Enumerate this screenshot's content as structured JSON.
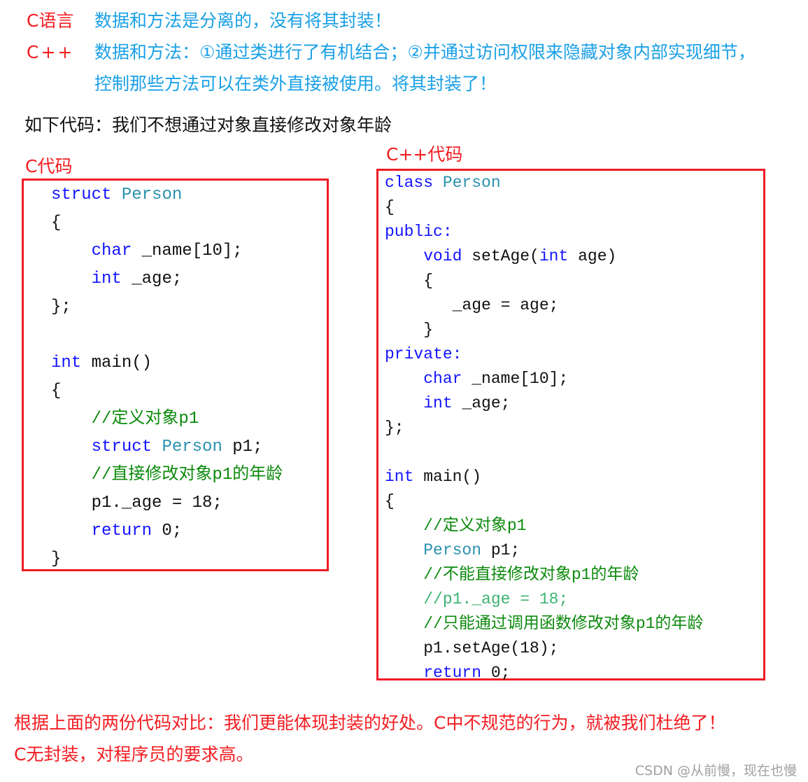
{
  "intro": {
    "c_label": "C语言",
    "c_text": "数据和方法是分离的，没有将其封装！",
    "cpp_label": "C++",
    "cpp_text_1": "数据和方法：①通过类进行了有机结合；②并通过访问权限来隐藏对象内部实现细节，",
    "cpp_text_2": "控制那些方法可以在类外直接被使用。将其封装了！",
    "code_intro": "如下代码：我们不想通过对象直接修改对象年龄"
  },
  "code_left": {
    "title": "C代码",
    "lines": [
      [
        [
          "struct",
          "kw"
        ],
        [
          " ",
          ""
        ],
        [
          "Person",
          "ty"
        ]
      ],
      [
        [
          "{",
          ""
        ]
      ],
      [
        [
          "    ",
          ""
        ],
        [
          "char",
          "kw"
        ],
        [
          " _name[10];",
          ""
        ]
      ],
      [
        [
          "    ",
          ""
        ],
        [
          "int",
          "kw"
        ],
        [
          " _age;",
          ""
        ]
      ],
      [
        [
          "};",
          ""
        ]
      ],
      [],
      [
        [
          "int",
          "kw"
        ],
        [
          " main()",
          ""
        ]
      ],
      [
        [
          "{",
          ""
        ]
      ],
      [
        [
          "    //定义对象p1",
          "cm"
        ]
      ],
      [
        [
          "    ",
          ""
        ],
        [
          "struct",
          "kw"
        ],
        [
          " ",
          ""
        ],
        [
          "Person",
          "ty"
        ],
        [
          " p1;",
          ""
        ]
      ],
      [
        [
          "    //直接修改对象p1的年龄",
          "cm"
        ]
      ],
      [
        [
          "    p1._age = 18;",
          ""
        ]
      ],
      [
        [
          "    ",
          ""
        ],
        [
          "return",
          "kw"
        ],
        [
          " 0;",
          ""
        ]
      ],
      [
        [
          "}",
          ""
        ]
      ]
    ]
  },
  "code_right": {
    "title": "C++代码",
    "lines": [
      [
        [
          "class",
          "kw"
        ],
        [
          " ",
          ""
        ],
        [
          "Person",
          "ty"
        ]
      ],
      [
        [
          "{",
          ""
        ]
      ],
      [
        [
          "public:",
          "kw"
        ]
      ],
      [
        [
          "    ",
          ""
        ],
        [
          "void",
          "kw"
        ],
        [
          " setAge(",
          ""
        ],
        [
          "int",
          "kw"
        ],
        [
          " age)",
          ""
        ]
      ],
      [
        [
          "    {",
          ""
        ]
      ],
      [
        [
          "       _age = age;",
          ""
        ]
      ],
      [
        [
          "    }",
          ""
        ]
      ],
      [
        [
          "private:",
          "kw"
        ]
      ],
      [
        [
          "    ",
          ""
        ],
        [
          "char",
          "kw"
        ],
        [
          " _name[10];",
          ""
        ]
      ],
      [
        [
          "    ",
          ""
        ],
        [
          "int",
          "kw"
        ],
        [
          " _age;",
          ""
        ]
      ],
      [
        [
          "};",
          ""
        ]
      ],
      [],
      [
        [
          "int",
          "kw"
        ],
        [
          " main()",
          ""
        ]
      ],
      [
        [
          "{",
          ""
        ]
      ],
      [
        [
          "    //定义对象p1",
          "cm"
        ]
      ],
      [
        [
          "    ",
          ""
        ],
        [
          "Person",
          "ty"
        ],
        [
          " p1;",
          ""
        ]
      ],
      [
        [
          "    //不能直接修改对象p1的年龄",
          "cm"
        ]
      ],
      [
        [
          "    //p1._age = 18;",
          "cm2"
        ]
      ],
      [
        [
          "    //只能通过调用函数修改对象p1的年龄",
          "cm"
        ]
      ],
      [
        [
          "    p1.setAge(18);",
          ""
        ]
      ],
      [
        [
          "    ",
          ""
        ],
        [
          "return",
          "kw"
        ],
        [
          " 0;",
          ""
        ]
      ]
    ]
  },
  "conclusion": {
    "line_1": "根据上面的两份代码对比：我们更能体现封装的好处。C中不规范的行为，就被我们杜绝了！",
    "line_2": "C无封装，对程序员的要求高。"
  },
  "watermark": "CSDN @从前慢，现在也慢",
  "colors": {
    "label_red": "#f31d22",
    "text_blue": "#1aa0e6",
    "keyword": "#1414ff",
    "type": "#2b91af",
    "comment": "#0c8a0c",
    "box_border": "#ee1c25"
  }
}
